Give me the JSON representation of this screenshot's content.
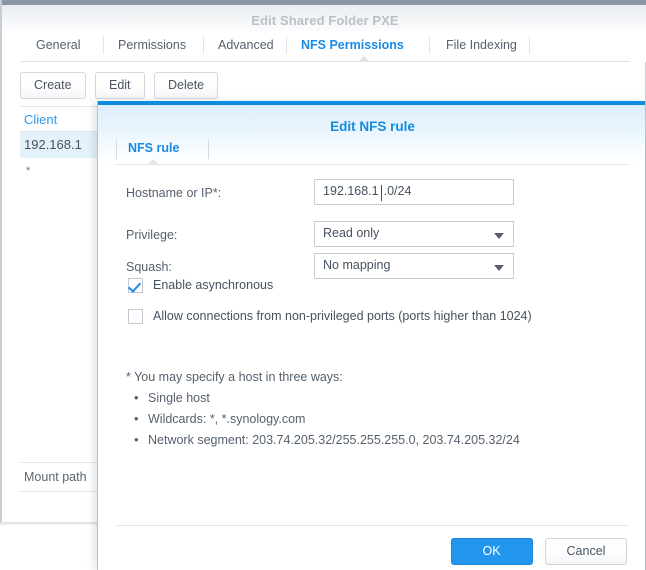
{
  "window": {
    "title": "Edit Shared Folder PXE",
    "tabs": [
      {
        "label": "General",
        "active": false
      },
      {
        "label": "Permissions",
        "active": false
      },
      {
        "label": "Advanced",
        "active": false
      },
      {
        "label": "NFS Permissions",
        "active": true
      },
      {
        "label": "File Indexing",
        "active": false
      }
    ],
    "toolbar": [
      {
        "label": "Create"
      },
      {
        "label": "Edit"
      },
      {
        "label": "Delete"
      }
    ],
    "client_table": {
      "header": "Client",
      "rows": [
        {
          "value": "192.168.1",
          "selected": true
        },
        {
          "value": "*",
          "selected": false
        }
      ]
    },
    "mount_path_label": "Mount path"
  },
  "dialog": {
    "title": "Edit NFS rule",
    "tab": "NFS rule",
    "fields": [
      {
        "label": "Hostname or IP*:",
        "value": "192.168.1.0/24",
        "type": "text",
        "caret_after": "192.168.1"
      },
      {
        "label": "Privilege:",
        "value": "Read only",
        "type": "select"
      },
      {
        "label": "Squash:",
        "value": "No mapping",
        "type": "select"
      }
    ],
    "checkboxes": [
      {
        "label": "Enable asynchronous",
        "checked": true
      },
      {
        "label": "Allow connections from non-privileged ports (ports higher than 1024)",
        "checked": false
      }
    ],
    "help": {
      "heading": "* You may specify a host in three ways:",
      "items": [
        "Single host",
        "Wildcards: *, *.synology.com",
        "Network segment: 203.74.205.32/255.255.255.0, 203.74.205.32/24"
      ]
    },
    "buttons": {
      "ok": "OK",
      "cancel": "Cancel"
    }
  },
  "colors": {
    "accent_blue": "#0d8ce0",
    "tab_active": "#1a8ae5",
    "primary_button": "#2196ec",
    "title_gray": "#b9c0ca",
    "row_selected": "#e3f1fb"
  }
}
